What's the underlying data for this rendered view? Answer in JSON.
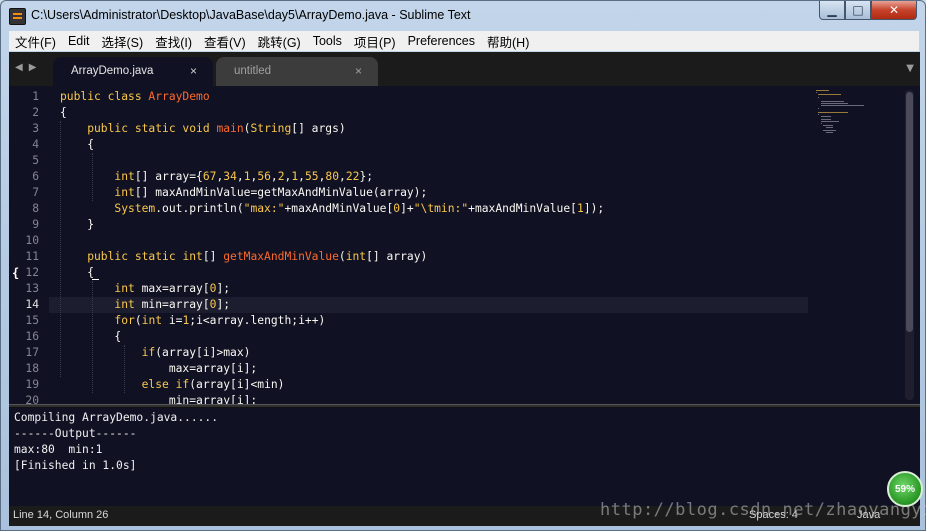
{
  "window": {
    "title": "C:\\Users\\Administrator\\Desktop\\JavaBase\\day5\\ArrayDemo.java - Sublime Text",
    "min_label": "▁",
    "max_label": "□",
    "close_label": "✕"
  },
  "menu": [
    "文件(F)",
    "Edit",
    "选择(S)",
    "查找(I)",
    "查看(V)",
    "跳转(G)",
    "Tools",
    "项目(P)",
    "Preferences",
    "帮助(H)"
  ],
  "tabs": [
    {
      "label": "ArrayDemo.java",
      "close": "×",
      "active": true
    },
    {
      "label": "untitled",
      "close": "×",
      "active": false
    }
  ],
  "nav": {
    "left": "◀",
    "right": "▶",
    "dropdown": "▼"
  },
  "code": {
    "current_line": 14,
    "lines": [
      {
        "n": "1",
        "segs": [
          [
            "public class ",
            "kw"
          ],
          [
            "ArrayDemo",
            "fn"
          ]
        ]
      },
      {
        "n": "2",
        "segs": [
          [
            "{",
            ""
          ]
        ]
      },
      {
        "n": "3",
        "segs": [
          [
            "    public static void ",
            "kw"
          ],
          [
            "main",
            "fn"
          ],
          [
            "(",
            ""
          ],
          [
            "String",
            "ty"
          ],
          [
            "[] args)",
            ""
          ]
        ]
      },
      {
        "n": "4",
        "segs": [
          [
            "    {",
            ""
          ]
        ]
      },
      {
        "n": "5",
        "segs": []
      },
      {
        "n": "6",
        "segs": [
          [
            "        ",
            ""
          ],
          [
            "int",
            "ty"
          ],
          [
            "[] array={",
            ""
          ],
          [
            "67",
            "num"
          ],
          [
            ",",
            ""
          ],
          [
            "34",
            "num"
          ],
          [
            ",",
            ""
          ],
          [
            "1",
            "num"
          ],
          [
            ",",
            ""
          ],
          [
            "56",
            "num"
          ],
          [
            ",",
            ""
          ],
          [
            "2",
            "num"
          ],
          [
            ",",
            ""
          ],
          [
            "1",
            "num"
          ],
          [
            ",",
            ""
          ],
          [
            "55",
            "num"
          ],
          [
            ",",
            ""
          ],
          [
            "80",
            "num"
          ],
          [
            ",",
            ""
          ],
          [
            "22",
            "num"
          ],
          [
            "};",
            ""
          ]
        ]
      },
      {
        "n": "7",
        "segs": [
          [
            "        ",
            ""
          ],
          [
            "int",
            "ty"
          ],
          [
            "[] maxAndMinValue=getMaxAndMinValue(array);",
            ""
          ]
        ]
      },
      {
        "n": "8",
        "segs": [
          [
            "        ",
            ""
          ],
          [
            "System",
            "ty"
          ],
          [
            ".out.println(",
            ""
          ],
          [
            "\"max:\"",
            "str"
          ],
          [
            "+maxAndMinValue[",
            ""
          ],
          [
            "0",
            "num"
          ],
          [
            "]+",
            ""
          ],
          [
            "\"\\tmin:\"",
            "str"
          ],
          [
            "+maxAndMinValue[",
            ""
          ],
          [
            "1",
            "num"
          ],
          [
            "]);",
            ""
          ]
        ]
      },
      {
        "n": "9",
        "segs": [
          [
            "    }",
            ""
          ]
        ]
      },
      {
        "n": "10",
        "segs": []
      },
      {
        "n": "11",
        "segs": [
          [
            "    public static ",
            "kw"
          ],
          [
            "int",
            "ty"
          ],
          [
            "[] ",
            ""
          ],
          [
            "getMaxAndMinValue",
            "fn"
          ],
          [
            "(",
            ""
          ],
          [
            "int",
            "ty"
          ],
          [
            "[] array)",
            ""
          ]
        ]
      },
      {
        "n": "12",
        "segs": [
          [
            "    {",
            ""
          ]
        ],
        "fold": "{"
      },
      {
        "n": "13",
        "segs": [
          [
            "        ",
            ""
          ],
          [
            "int",
            "ty"
          ],
          [
            " max=array[",
            ""
          ],
          [
            "0",
            "num"
          ],
          [
            "];",
            ""
          ]
        ]
      },
      {
        "n": "14",
        "segs": [
          [
            "        ",
            ""
          ],
          [
            "int",
            "ty"
          ],
          [
            " min=array[",
            ""
          ],
          [
            "0",
            "num"
          ],
          [
            "];",
            ""
          ]
        ]
      },
      {
        "n": "15",
        "segs": [
          [
            "        ",
            ""
          ],
          [
            "for",
            "kw"
          ],
          [
            "(",
            ""
          ],
          [
            "int",
            "ty"
          ],
          [
            " i=",
            ""
          ],
          [
            "1",
            "num"
          ],
          [
            ";i<array.length;i++)",
            ""
          ]
        ]
      },
      {
        "n": "16",
        "segs": [
          [
            "        {",
            ""
          ]
        ]
      },
      {
        "n": "17",
        "segs": [
          [
            "            ",
            ""
          ],
          [
            "if",
            "kw"
          ],
          [
            "(array[i]>max)",
            ""
          ]
        ]
      },
      {
        "n": "18",
        "segs": [
          [
            "                max=array[i];",
            ""
          ]
        ]
      },
      {
        "n": "19",
        "segs": [
          [
            "            ",
            ""
          ],
          [
            "else if",
            "kw"
          ],
          [
            "(array[i]<min)",
            ""
          ]
        ]
      },
      {
        "n": "20",
        "segs": [
          [
            "                min=array[i];",
            ""
          ]
        ]
      }
    ]
  },
  "console": {
    "lines": [
      "Compiling ArrayDemo.java......",
      "------Output------",
      "max:80  min:1",
      "[Finished in 1.0s]"
    ]
  },
  "status": {
    "position": "Line 14, Column 26",
    "indent": "Spaces: 4",
    "syntax": "Java"
  },
  "badge": "59%",
  "watermark": "http://blog.csdn.net/zhaoyangyi",
  "colors": {
    "keyword": "#f9c84a",
    "function": "#fb6a2c",
    "background": "#111124",
    "text": "#f8f8f2"
  }
}
